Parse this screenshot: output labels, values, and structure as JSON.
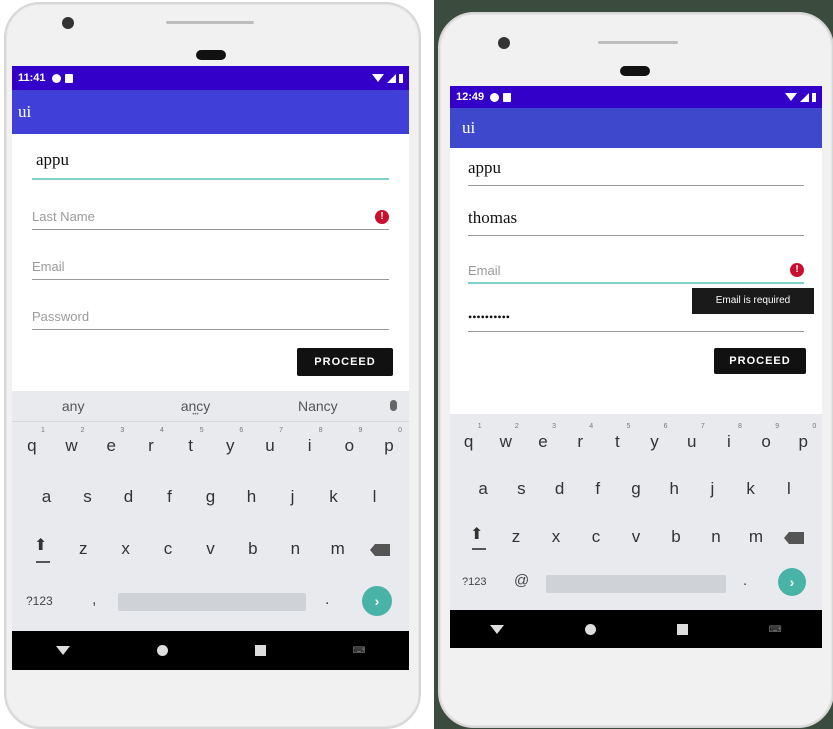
{
  "colors": {
    "status_bar": "#3200c8",
    "app_bar": "#4040d8",
    "app_bar_2": "#3d48cc",
    "focus_underline": "#7fd1cd",
    "error": "#c8102e",
    "enter_key": "#49b3a7"
  },
  "icons": {
    "error": "error-circle-icon",
    "enter": "chevron-right-icon",
    "shift": "shift-arrow-icon",
    "backspace": "backspace-icon",
    "mic": "microphone-icon"
  },
  "left": {
    "status": {
      "time": "11:41"
    },
    "app_title": "ui",
    "fields": {
      "first_name": {
        "value": "appu"
      },
      "last_name": {
        "placeholder": "Last Name",
        "error_glyph": "!"
      },
      "email": {
        "placeholder": "Email"
      },
      "password": {
        "placeholder": "Password"
      }
    },
    "proceed_label": "PROCEED",
    "suggestions": [
      "any",
      "ancy",
      "Nancy"
    ],
    "suggestion_dots": "•••",
    "keyboard": {
      "row1": [
        {
          "k": "q",
          "n": "1"
        },
        {
          "k": "w",
          "n": "2"
        },
        {
          "k": "e",
          "n": "3"
        },
        {
          "k": "r",
          "n": "4"
        },
        {
          "k": "t",
          "n": "5"
        },
        {
          "k": "y",
          "n": "6"
        },
        {
          "k": "u",
          "n": "7"
        },
        {
          "k": "i",
          "n": "8"
        },
        {
          "k": "o",
          "n": "9"
        },
        {
          "k": "p",
          "n": "0"
        }
      ],
      "row2": [
        "a",
        "s",
        "d",
        "f",
        "g",
        "h",
        "j",
        "k",
        "l"
      ],
      "row3": [
        "z",
        "x",
        "c",
        "v",
        "b",
        "n",
        "m"
      ],
      "sym": "?123",
      "comma": ",",
      "period": ".",
      "enter": "›",
      "shift": "⬆"
    },
    "nav_kb": "⌨"
  },
  "right": {
    "status": {
      "time": "12:49"
    },
    "app_title": "ui",
    "fields": {
      "first_name": {
        "value": "appu"
      },
      "last_name": {
        "value": "thomas"
      },
      "email": {
        "placeholder": "Email",
        "error_glyph": "!",
        "tooltip": "Email is required"
      },
      "password": {
        "value": "••••••••••"
      }
    },
    "proceed_label": "PROCEED",
    "keyboard": {
      "row1": [
        {
          "k": "q",
          "n": "1"
        },
        {
          "k": "w",
          "n": "2"
        },
        {
          "k": "e",
          "n": "3"
        },
        {
          "k": "r",
          "n": "4"
        },
        {
          "k": "t",
          "n": "5"
        },
        {
          "k": "y",
          "n": "6"
        },
        {
          "k": "u",
          "n": "7"
        },
        {
          "k": "i",
          "n": "8"
        },
        {
          "k": "o",
          "n": "9"
        },
        {
          "k": "p",
          "n": "0"
        }
      ],
      "row2": [
        "a",
        "s",
        "d",
        "f",
        "g",
        "h",
        "j",
        "k",
        "l"
      ],
      "row3": [
        "z",
        "x",
        "c",
        "v",
        "b",
        "n",
        "m"
      ],
      "sym": "?123",
      "at": "@",
      "period": ".",
      "enter": "›",
      "shift": "⬆"
    },
    "nav_kb": "⌨"
  }
}
